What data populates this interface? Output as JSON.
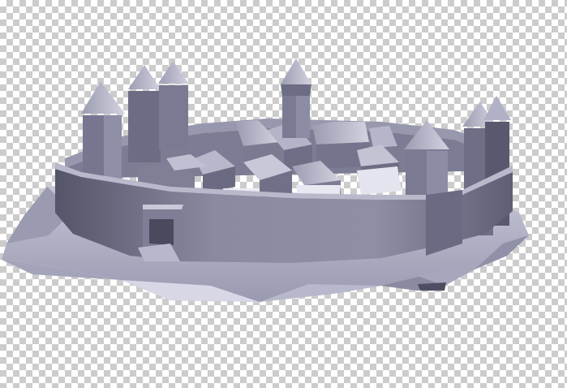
{
  "canvas": {
    "background": "transparency-checkerboard",
    "checker_colors": [
      "#ffffff",
      "#cccccc"
    ]
  },
  "model": {
    "subject": "walled-castle-town",
    "render_style": "flat-shaded-3d",
    "tint": "#8f8fa8",
    "parts": [
      "rocky-base",
      "oval-curtain-wall",
      "gatehouse",
      "corner-towers",
      "central-tower",
      "town-houses"
    ]
  }
}
